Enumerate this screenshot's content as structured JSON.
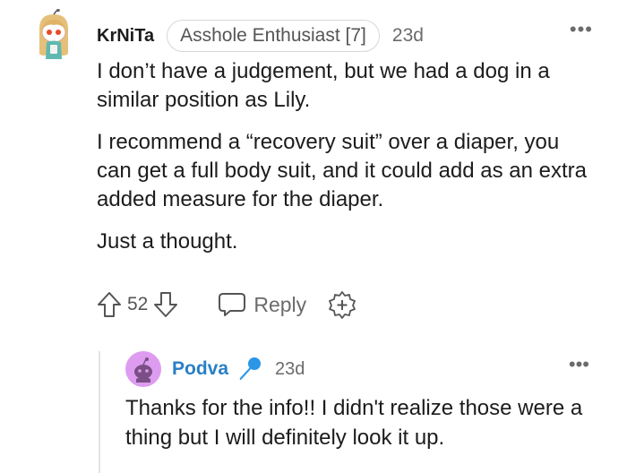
{
  "comment": {
    "username": "KrNiTa",
    "flair": "Asshole Enthusiast [7]",
    "timestamp": "23d",
    "more": "•••",
    "paragraphs": [
      "I don’t have a judgement, but we had a dog in a similar position as Lily.",
      "I recommend a “recovery suit” over a diaper, you can get a full body suit, and it could add as an extra added measure for the diaper.",
      "Just a thought."
    ],
    "vote_count": "52",
    "reply_label": "Reply"
  },
  "reply": {
    "username": "Podva",
    "timestamp": "23d",
    "more": "•••",
    "body": "Thanks for the info!! I didn't realize those were a thing but I will definitely look it up."
  },
  "colors": {
    "username_blue": "#2a7fc5",
    "avatar_purple": "#dd9cf0",
    "mic_blue": "#2a96e8",
    "muted": "#6b6b6b"
  },
  "icons": [
    "avatar",
    "upvote-icon",
    "downvote-icon",
    "reply-icon",
    "award-icon",
    "microphone-icon",
    "more-icon"
  ]
}
